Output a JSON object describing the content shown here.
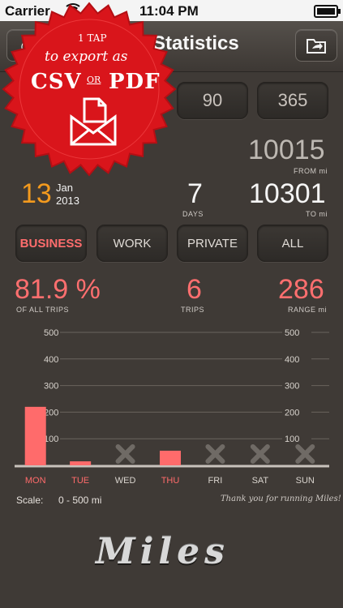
{
  "status_bar": {
    "carrier": "Carrier",
    "time": "11:04 PM"
  },
  "nav": {
    "title": "Statistics"
  },
  "promo": {
    "line1": "1 TAP",
    "line2": "to export as",
    "csv": "CSV",
    "or": "OR",
    "pdf": "PDF"
  },
  "periods": [
    "90",
    "365"
  ],
  "summary": {
    "date_day": "13",
    "date_month": "Jan",
    "date_year": "2013",
    "days_value": "7",
    "days_label": "DAYS",
    "from_value": "10015",
    "from_label": "FROM mi",
    "to_value": "10301",
    "to_label": "TO mi"
  },
  "filters": [
    {
      "label": "BUSINESS",
      "active": true
    },
    {
      "label": "WORK",
      "active": false
    },
    {
      "label": "PRIVATE",
      "active": false
    },
    {
      "label": "ALL",
      "active": false
    }
  ],
  "stats": {
    "percent_value": "81.9 %",
    "percent_label": "OF ALL TRIPS",
    "trips_value": "6",
    "trips_label": "TRIPS",
    "range_value": "286",
    "range_label": "RANGE mi"
  },
  "chart_data": {
    "type": "bar",
    "categories": [
      "MON",
      "TUE",
      "WED",
      "THU",
      "FRI",
      "SAT",
      "SUN"
    ],
    "values": [
      220,
      15,
      null,
      55,
      null,
      null,
      null
    ],
    "ylim": [
      0,
      500
    ],
    "yticks": [
      100,
      200,
      300,
      400,
      500
    ],
    "bar_color": "#ff6b6b",
    "grid": true
  },
  "footer": {
    "scale_label": "Scale:",
    "scale_range": "0 - 500 mi",
    "thanks": "Thank you for running Miles!",
    "logo": "Miles"
  },
  "colors": {
    "accent_red": "#ff6b6b",
    "date_orange": "#f39a1e",
    "promo_red": "#d9151b"
  }
}
